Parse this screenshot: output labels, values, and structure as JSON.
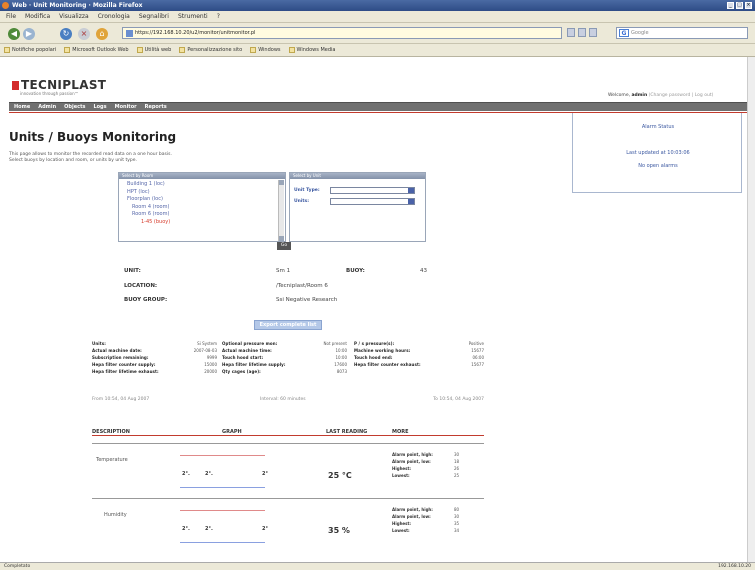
{
  "window": {
    "title": "Web · Unit Monitoring · Mozilla Firefox"
  },
  "menu": [
    "File",
    "Modifica",
    "Visualizza",
    "Cronologia",
    "Segnalibri",
    "Strumenti",
    "?"
  ],
  "address": {
    "url": "https://192.168.10.20/u2/monitor/unitmonitor.pl",
    "search_placeholder": "Google"
  },
  "bookmarks": [
    "Notifiche popolari",
    "Microsoft Outlook Web",
    "Utilità web",
    "Personalizzazione sito",
    "Windows",
    "Windows Media"
  ],
  "header": {
    "logo": "TECNIPLAST",
    "tagline": "innovation through passion™",
    "welcome_prefix": "Welcome,",
    "user": "admin",
    "welcome_links": "(Change password | Log out)"
  },
  "nav": [
    "Home",
    "Admin",
    "Objects",
    "Logs",
    "Monitor",
    "Reports"
  ],
  "page": {
    "title": "Units / Buoys Monitoring",
    "intro1": "This page allows to monitor the recorded read data on a one hour basis.",
    "intro2": "Select buoys by location and room, or units by unit type."
  },
  "alarm": {
    "title": "Alarm Status",
    "updated": "Last updated at 10:03:06",
    "status": "No open alarms"
  },
  "filters": {
    "panel1_head": "Select by Room",
    "panel2_head": "Select by Unit",
    "tree": [
      "Building 1 (loc)",
      "HPT (loc)",
      "Floorplan (loc)",
      "Room 4 (room)",
      "Room 6 (room)",
      "1-45 (buoy)"
    ],
    "unit_type_label": "Unit Type:",
    "units_label": "Units:",
    "go": "Go"
  },
  "unit_info": {
    "unit_label": "UNIT:",
    "unit": "Sm 1",
    "buoy_label": "BUOY:",
    "buoy": "43",
    "location_label": "LOCATION:",
    "location": "/Tecniplast/Room 6",
    "group_label": "BUOY GROUP:",
    "group": "Ssi Negative Research"
  },
  "export": "Export complete list",
  "stats": [
    {
      "label": "Units:",
      "value": "Si System"
    },
    {
      "label": "Optional pressure mon:",
      "value": "Not present"
    },
    {
      "label": "P / s pressure(s):",
      "value": "Positive"
    },
    {
      "label": "Actual machine date:",
      "value": "2007-08-03"
    },
    {
      "label": "Actual machine time:",
      "value": "10:00"
    },
    {
      "label": "Machine working hours:",
      "value": "15677"
    },
    {
      "label": "Subscription remaining:",
      "value": "9999"
    },
    {
      "label": "Touch hood start:",
      "value": "10:00"
    },
    {
      "label": "Touch hood end:",
      "value": "06:00"
    },
    {
      "label": "Hepa filter counter supply:",
      "value": "15000"
    },
    {
      "label": "Hepa filter lifetime supply:",
      "value": "17600"
    },
    {
      "label": "Hepa filter counter exhaust:",
      "value": "15677"
    },
    {
      "label": "Hepa filter lifetime exhaust:",
      "value": "20000"
    },
    {
      "label": "Qty cages (age):",
      "value": "8073"
    }
  ],
  "range": {
    "from": "From 10:54, 04 Aug 2007",
    "interval": "Interval: 60 minutes",
    "to": "To 10:54, 04 Aug 2007"
  },
  "table": {
    "headers": [
      "DESCRIPTION",
      "GRAPH",
      "LAST READING",
      "MORE"
    ],
    "rows": [
      {
        "desc": "Temperature",
        "reading": "25 °C",
        "points": [
          "2°.",
          "2°.",
          "2°"
        ],
        "alarms": [
          {
            "label": "Alarm point, high:",
            "value": "30"
          },
          {
            "label": "Alarm point, low:",
            "value": "18"
          },
          {
            "label": "Highest:",
            "value": "26"
          },
          {
            "label": "Lowest:",
            "value": "25"
          }
        ]
      },
      {
        "desc": "Humidity",
        "reading": "35 %",
        "points": [
          "2°.",
          "2°.",
          "2°"
        ],
        "alarms": [
          {
            "label": "Alarm point, high:",
            "value": "80"
          },
          {
            "label": "Alarm point, low:",
            "value": "30"
          },
          {
            "label": "Highest:",
            "value": "35"
          },
          {
            "label": "Lowest:",
            "value": "34"
          }
        ]
      }
    ]
  },
  "status": {
    "left": "Completato",
    "right": "192.168.10.20"
  }
}
